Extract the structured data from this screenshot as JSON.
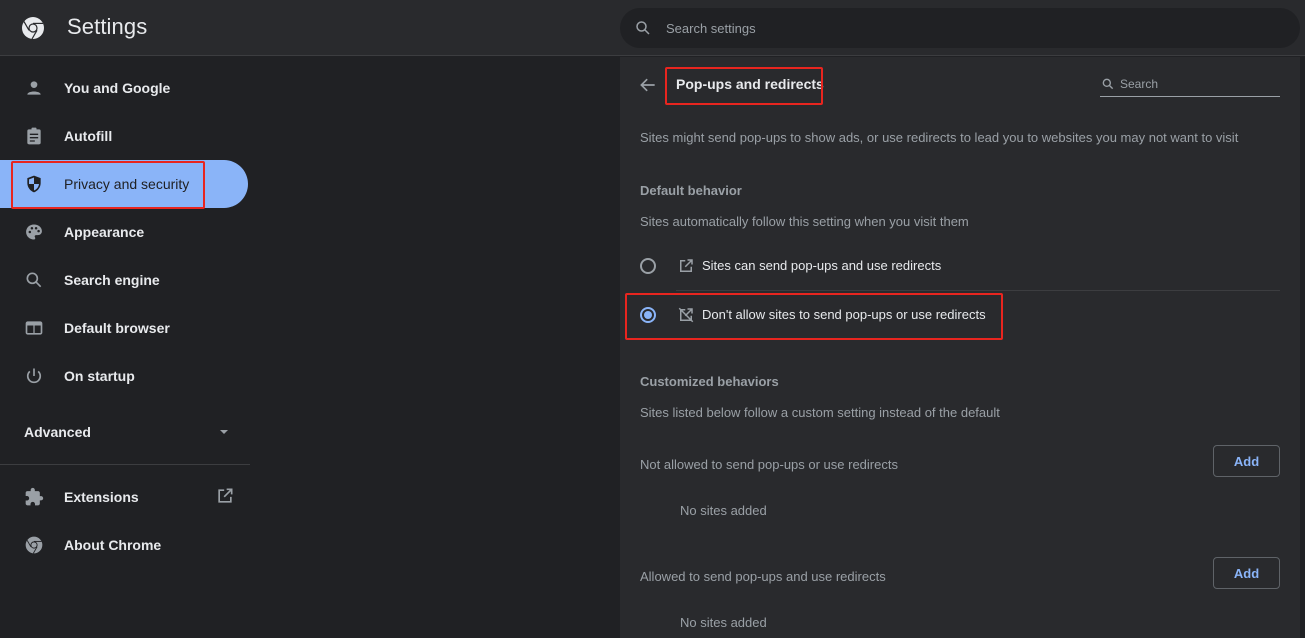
{
  "header": {
    "title": "Settings",
    "logo_icon": "chrome-logo-icon",
    "search_placeholder": "Search settings"
  },
  "sidebar": {
    "items": [
      {
        "label": "You and Google",
        "icon": "person-icon",
        "active": false
      },
      {
        "label": "Autofill",
        "icon": "clipboard-icon",
        "active": false
      },
      {
        "label": "Privacy and security",
        "icon": "shield-icon",
        "active": true
      },
      {
        "label": "Appearance",
        "icon": "palette-icon",
        "active": false
      },
      {
        "label": "Search engine",
        "icon": "search-icon",
        "active": false
      },
      {
        "label": "Default browser",
        "icon": "browser-icon",
        "active": false
      },
      {
        "label": "On startup",
        "icon": "power-icon",
        "active": false
      }
    ],
    "advanced_label": "Advanced",
    "extensions_label": "Extensions",
    "about_label": "About Chrome"
  },
  "main": {
    "title": "Pop-ups and redirects",
    "search_placeholder": "Search",
    "description": "Sites might send pop-ups to show ads, or use redirects to lead you to websites you may not want to visit",
    "default_behavior": {
      "heading": "Default behavior",
      "subtext": "Sites automatically follow this setting when you visit them",
      "options": [
        {
          "label": "Sites can send pop-ups and use redirects",
          "icon": "open-in-new-icon",
          "checked": false
        },
        {
          "label": "Don't allow sites to send pop-ups or use redirects",
          "icon": "popup-blocked-icon",
          "checked": true
        }
      ]
    },
    "customized": {
      "heading": "Customized behaviors",
      "subtext": "Sites listed below follow a custom setting instead of the default",
      "lists": [
        {
          "label": "Not allowed to send pop-ups or use redirects",
          "add_label": "Add",
          "empty_text": "No sites added"
        },
        {
          "label": "Allowed to send pop-ups and use redirects",
          "add_label": "Add",
          "empty_text": "No sites added"
        }
      ]
    }
  },
  "colors": {
    "accent": "#8ab4f8",
    "highlight_box": "#e8251f",
    "background": "#202124",
    "card": "#292a2d"
  }
}
